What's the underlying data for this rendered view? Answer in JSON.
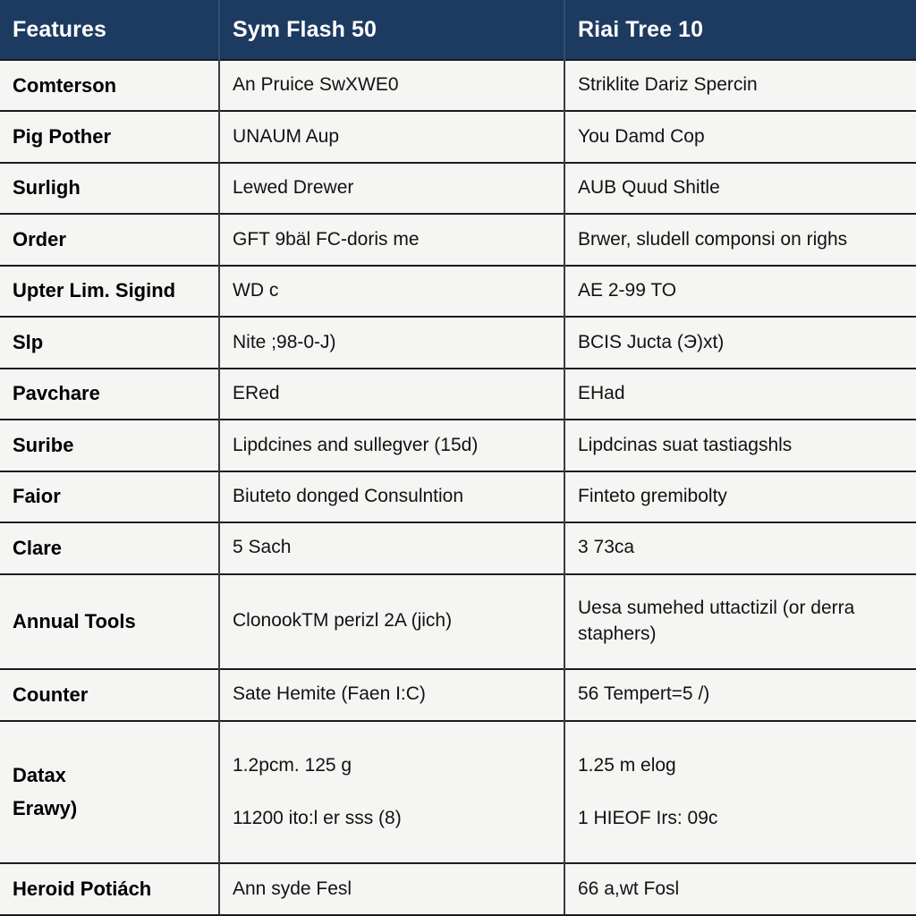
{
  "table": {
    "headers": [
      {
        "label": "Features"
      },
      {
        "label": "Sym Flash 50"
      },
      {
        "label": "Riai Tree 10"
      }
    ],
    "rows": [
      {
        "feature": "Comterson",
        "col_a": "An Pruice SwXWE0",
        "col_b": "Striklite Dariz Spercin"
      },
      {
        "feature": "Pig Pother",
        "col_a": "UNAUM Aup",
        "col_b": "You Damd Cop"
      },
      {
        "feature": "Surligh",
        "col_a": "Lewed Drewer",
        "col_b": "AUB Quud Shitle"
      },
      {
        "feature": "Order",
        "col_a": "GFT 9bäl FC-doris me",
        "col_b": "Brwer, sludell componsi on righs"
      },
      {
        "feature": "Upter Lim. Sigind",
        "col_a": "WD c",
        "col_b": "AE 2-99 TO"
      },
      {
        "feature": "Slp",
        "col_a": "Nite ;98-0-J)",
        "col_b": "BCIS Jucta (Э)xt)"
      },
      {
        "feature": "Pavchare",
        "col_a": "ERed",
        "col_b": "EHad"
      },
      {
        "feature": "Suribe",
        "col_a": "Lipdcines and sullegver (15d)",
        "col_b": "Lipdcinas suat tastiagshls"
      },
      {
        "feature": "Faior",
        "col_a": "Biuteto donged Consulntion",
        "col_b": "Finteto gremibolty"
      },
      {
        "feature": "Clare",
        "col_a": "5 Sach",
        "col_b": "3 73ca"
      },
      {
        "feature": "Annual Tools",
        "col_a": "ClonookTM perizl 2A (jich)",
        "col_b": "Uesa sumehed uttactizil (or derra staphers)"
      },
      {
        "feature": "Counter",
        "col_a": "Sate Hemite (Faen I:C)",
        "col_b": "56 Tempert=5 /)"
      },
      {
        "feature_line1": "Datax",
        "feature_line2": "Erawy)",
        "col_a_line1": "1.2pcm. 125 g",
        "col_a_line2": "11200 ito:l er sss (8)",
        "col_b_line1": "1.25 m elog",
        "col_b_line2": "1 HIEOF Irs: 09c"
      },
      {
        "feature": "Heroid Potiách",
        "col_a": "Ann syde Fesl",
        "col_b": "66 a,wt Fosl"
      }
    ]
  },
  "colors": {
    "header_background": "#1d3a61",
    "header_text": "#ffffff",
    "row_background": "#f5f5f3",
    "border": "#1b1b22",
    "body_text": "#121212"
  }
}
